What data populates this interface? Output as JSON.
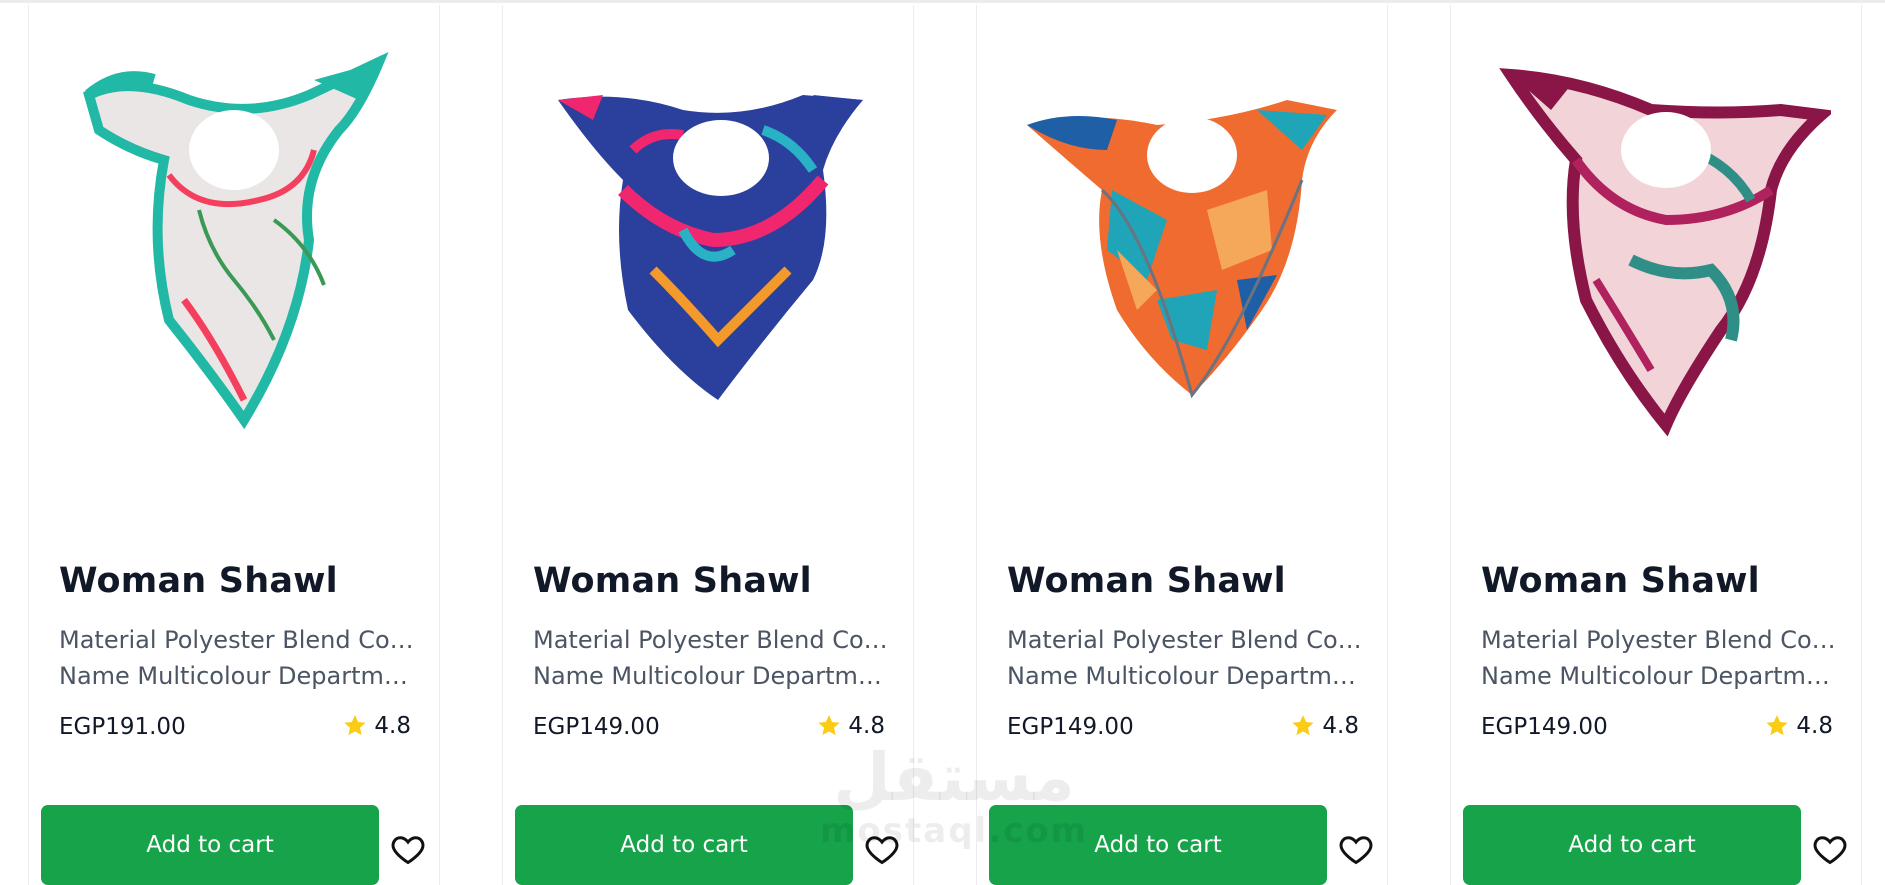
{
  "products": [
    {
      "title": "Woman Shawl",
      "desc_line1": "Material Polyester Blend Colour",
      "desc_line2": "Name Multicolour Department…",
      "price": "EGP191.00",
      "rating": "4.8",
      "cart_label": "Add to cart",
      "image_icon": "scarf-image",
      "colors": {
        "base": "#eae6e6",
        "accent1": "#22b8a6",
        "accent2": "#f43f5e",
        "accent3": "#3a9a55"
      }
    },
    {
      "title": "Woman Shawl",
      "desc_line1": "Material Polyester Blend Colour",
      "desc_line2": "Name Multicolour Department…",
      "price": "EGP149.00",
      "rating": "4.8",
      "cart_label": "Add to cart",
      "image_icon": "scarf-image",
      "colors": {
        "base": "#2b3f9c",
        "accent1": "#f0266f",
        "accent2": "#f39a2a",
        "accent3": "#29b1c6"
      }
    },
    {
      "title": "Woman Shawl",
      "desc_line1": "Material Polyester Blend Colour",
      "desc_line2": "Name Multicolour Department…",
      "price": "EGP149.00",
      "rating": "4.8",
      "cart_label": "Add to cart",
      "image_icon": "scarf-image",
      "colors": {
        "base": "#ef6b2f",
        "accent1": "#1fa4b8",
        "accent2": "#f6a85a",
        "accent3": "#1e5fa6"
      }
    },
    {
      "title": "Woman Shawl",
      "desc_line1": "Material Polyester Blend Colour",
      "desc_line2": "Name Multicolour Department…",
      "price": "EGP149.00",
      "rating": "4.8",
      "cart_label": "Add to cart",
      "image_icon": "scarf-image",
      "colors": {
        "base": "#f2d3d8",
        "accent1": "#8a1648",
        "accent2": "#2f8f86",
        "accent3": "#b0225e"
      }
    }
  ],
  "watermark": {
    "arabic": "مستقل",
    "latin": "mostaql.com"
  },
  "theme": {
    "cart_button": "#16a34a",
    "star": "#facc15",
    "title": "#111827",
    "desc": "#4b5563"
  },
  "icons": {
    "star": "star-icon",
    "heart": "heart-icon"
  }
}
